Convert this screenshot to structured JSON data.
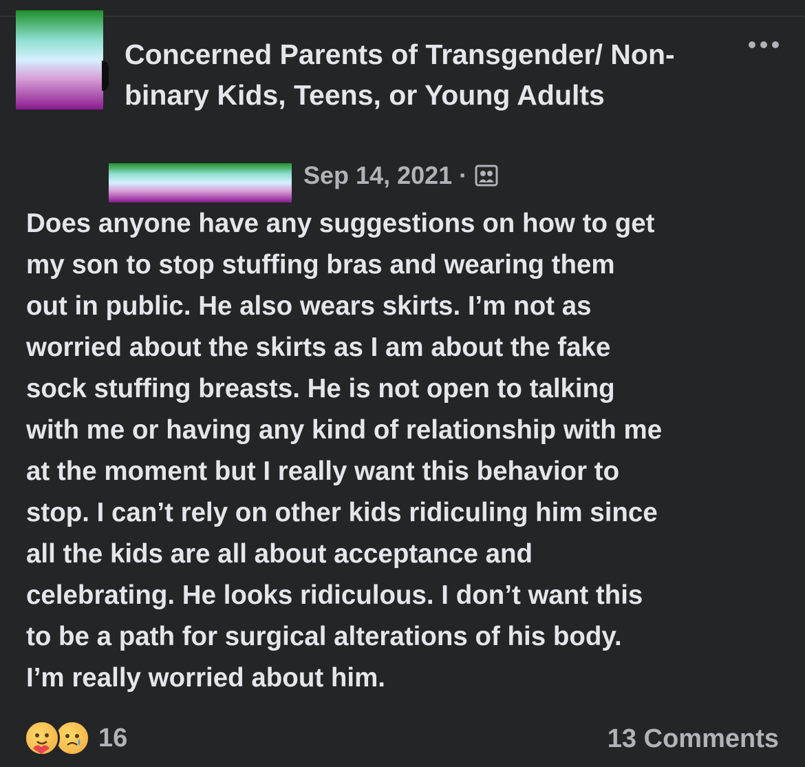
{
  "group": {
    "name": "Concerned Parents of Transgender/ Non-binary Kids, Teens, or Young Adults"
  },
  "post": {
    "date": "Sep 14, 2021",
    "separator": "·",
    "audience_icon": "group-members-icon",
    "text": "Does anyone have any suggestions on how to get\nmy son to stop stuffing bras and wearing them\nout in public. He also wears skirts. I’m not as\nworried about the skirts as I am about the fake\nsock stuffing breasts. He is not open to talking\nwith me or having any kind of relationship with me\nat the moment but I really want this behavior to\nstop. I can’t rely on other kids ridiculing him since\nall the kids are all about acceptance and\ncelebrating. He looks ridiculous. I don’t want this\nto be a path for surgical alterations of his body.\nI’m really worried about him."
  },
  "footer": {
    "reactions": [
      "care-emoji",
      "sad-emoji"
    ],
    "reaction_count": "16",
    "comments_label": "13 Comments"
  },
  "colors": {
    "background": "#242526",
    "text_primary": "#e4e6eb",
    "text_secondary": "#b0b3b8"
  }
}
